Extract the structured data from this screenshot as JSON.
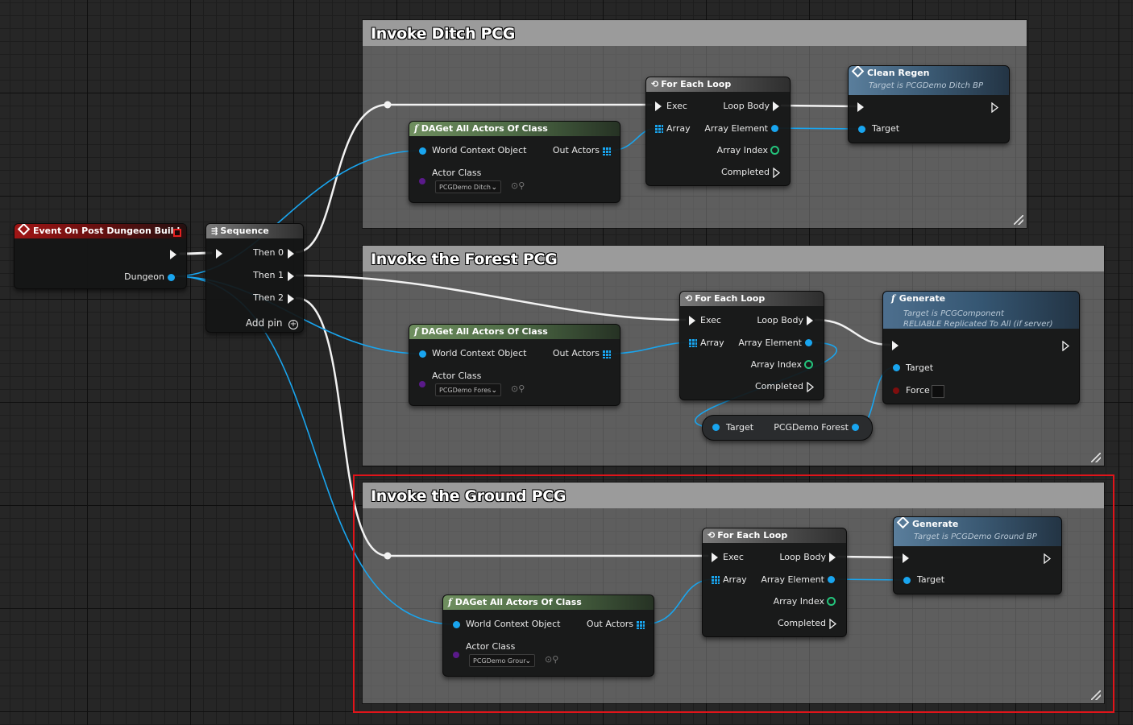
{
  "comments": [
    {
      "title": "Invoke Ditch PCG"
    },
    {
      "title": "Invoke the Forest PCG"
    },
    {
      "title": "Invoke the Ground PCG"
    }
  ],
  "event_node": {
    "title": "Event On Post Dungeon Build",
    "pin_dungeon": "Dungeon"
  },
  "sequence_node": {
    "title": "Sequence",
    "then0": "Then 0",
    "then1": "Then 1",
    "then2": "Then 2",
    "add_pin": "Add pin"
  },
  "get_actors": [
    {
      "title": "DAGet All Actors Of Class",
      "world_context": "World Context Object",
      "out_actors": "Out Actors",
      "actor_class": "Actor Class",
      "class_value": "PCGDemo Ditch"
    },
    {
      "title": "DAGet All Actors Of Class",
      "world_context": "World Context Object",
      "out_actors": "Out Actors",
      "actor_class": "Actor Class",
      "class_value": "PCGDemo Fores"
    },
    {
      "title": "DAGet All Actors Of Class",
      "world_context": "World Context Object",
      "out_actors": "Out Actors",
      "actor_class": "Actor Class",
      "class_value": "PCGDemo Grour"
    }
  ],
  "foreach": [
    {
      "title": "For Each Loop",
      "exec": "Exec",
      "loop_body": "Loop Body",
      "array": "Array",
      "array_element": "Array Element",
      "array_index": "Array Index",
      "completed": "Completed"
    },
    {
      "title": "For Each Loop",
      "exec": "Exec",
      "loop_body": "Loop Body",
      "array": "Array",
      "array_element": "Array Element",
      "array_index": "Array Index",
      "completed": "Completed"
    },
    {
      "title": "For Each Loop",
      "exec": "Exec",
      "loop_body": "Loop Body",
      "array": "Array",
      "array_element": "Array Element",
      "array_index": "Array Index",
      "completed": "Completed"
    }
  ],
  "clean_regen": {
    "title": "Clean Regen",
    "subtitle": "Target is PCGDemo Ditch BP",
    "target": "Target"
  },
  "generate_forest": {
    "title": "Generate",
    "subtitle1": "Target is PCGComponent",
    "subtitle2": "RELIABLE Replicated To All (if server)",
    "target": "Target",
    "force": "Force"
  },
  "forest_var": {
    "target": "Target",
    "value": "PCGDemo Forest"
  },
  "generate_ground": {
    "title": "Generate",
    "subtitle": "Target is PCGDemo Ground BP",
    "target": "Target"
  },
  "colors": {
    "exec": "#f2f2f2",
    "object_pin": "#19a5ef",
    "int_pin": "#24c47c",
    "class_pin": "#5a1a8a",
    "bool_pin": "#7e0e0e",
    "highlight": "#e0141a"
  }
}
